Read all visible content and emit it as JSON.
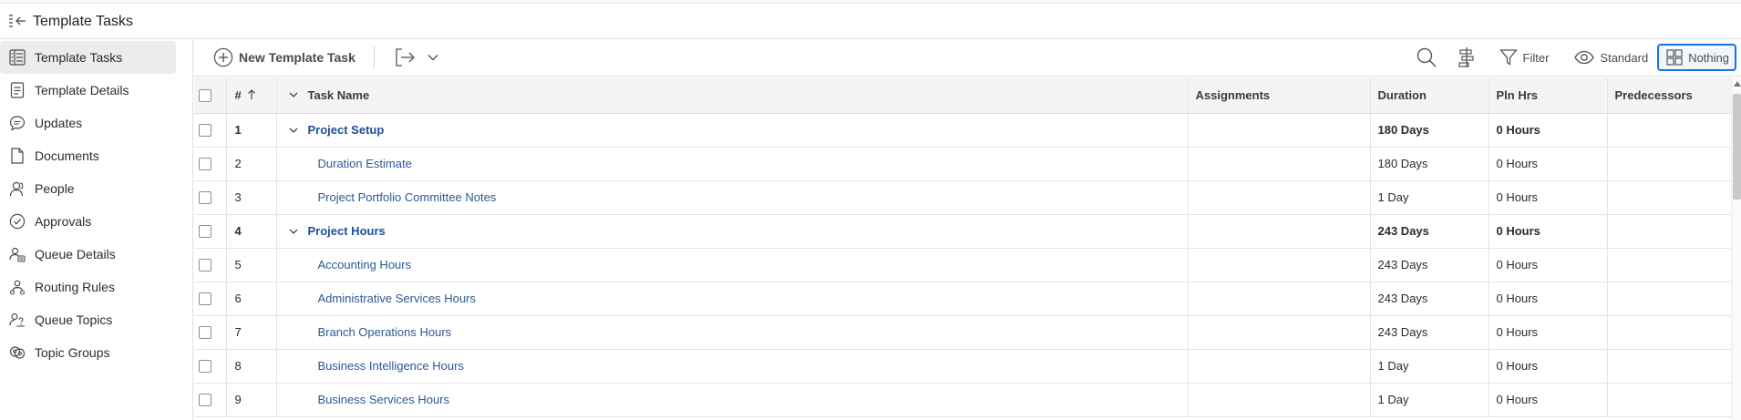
{
  "app": {
    "title": "Template Tasks"
  },
  "sidebar": {
    "items": [
      {
        "label": "Template Tasks",
        "icon": "task-list-icon",
        "active": true
      },
      {
        "label": "Template Details",
        "icon": "details-icon",
        "active": false
      },
      {
        "label": "Updates",
        "icon": "comment-icon",
        "active": false
      },
      {
        "label": "Documents",
        "icon": "document-icon",
        "active": false
      },
      {
        "label": "People",
        "icon": "people-icon",
        "active": false
      },
      {
        "label": "Approvals",
        "icon": "approval-check-icon",
        "active": false
      },
      {
        "label": "Queue Details",
        "icon": "queue-details-icon",
        "active": false
      },
      {
        "label": "Routing Rules",
        "icon": "routing-rules-icon",
        "active": false
      },
      {
        "label": "Queue Topics",
        "icon": "queue-topics-icon",
        "active": false
      },
      {
        "label": "Topic Groups",
        "icon": "topic-groups-icon",
        "active": false
      }
    ]
  },
  "toolbar": {
    "new_task_label": "New Template Task",
    "filter_label": "Filter",
    "view_label": "Standard",
    "grouping_label": "Nothing"
  },
  "table": {
    "columns": {
      "num": "#",
      "task_name": "Task Name",
      "assignments": "Assignments",
      "duration": "Duration",
      "pln_hrs": "Pln Hrs",
      "predecessors": "Predecessors"
    },
    "rows": [
      {
        "num": "1",
        "name": "Project Setup",
        "assignments": "",
        "duration": "180 Days",
        "pln_hrs": "0 Hours",
        "predecessors": "",
        "parent": true
      },
      {
        "num": "2",
        "name": "Duration Estimate",
        "assignments": "",
        "duration": "180 Days",
        "pln_hrs": "0 Hours",
        "predecessors": "",
        "parent": false
      },
      {
        "num": "3",
        "name": "Project Portfolio Committee Notes",
        "assignments": "",
        "duration": "1 Day",
        "pln_hrs": "0 Hours",
        "predecessors": "",
        "parent": false
      },
      {
        "num": "4",
        "name": "Project Hours",
        "assignments": "",
        "duration": "243 Days",
        "pln_hrs": "0 Hours",
        "predecessors": "",
        "parent": true
      },
      {
        "num": "5",
        "name": "Accounting Hours",
        "assignments": "",
        "duration": "243 Days",
        "pln_hrs": "0 Hours",
        "predecessors": "",
        "parent": false
      },
      {
        "num": "6",
        "name": "Administrative Services Hours",
        "assignments": "",
        "duration": "243 Days",
        "pln_hrs": "0 Hours",
        "predecessors": "",
        "parent": false
      },
      {
        "num": "7",
        "name": "Branch Operations Hours",
        "assignments": "",
        "duration": "243 Days",
        "pln_hrs": "0 Hours",
        "predecessors": "",
        "parent": false
      },
      {
        "num": "8",
        "name": "Business Intelligence Hours",
        "assignments": "",
        "duration": "1 Day",
        "pln_hrs": "0 Hours",
        "predecessors": "",
        "parent": false
      },
      {
        "num": "9",
        "name": "Business Services Hours",
        "assignments": "",
        "duration": "1 Day",
        "pln_hrs": "0 Hours",
        "predecessors": "",
        "parent": false
      }
    ]
  },
  "colors": {
    "accent": "#1473e6",
    "link": "#2c5894",
    "sidebar_active": "#ececec"
  }
}
